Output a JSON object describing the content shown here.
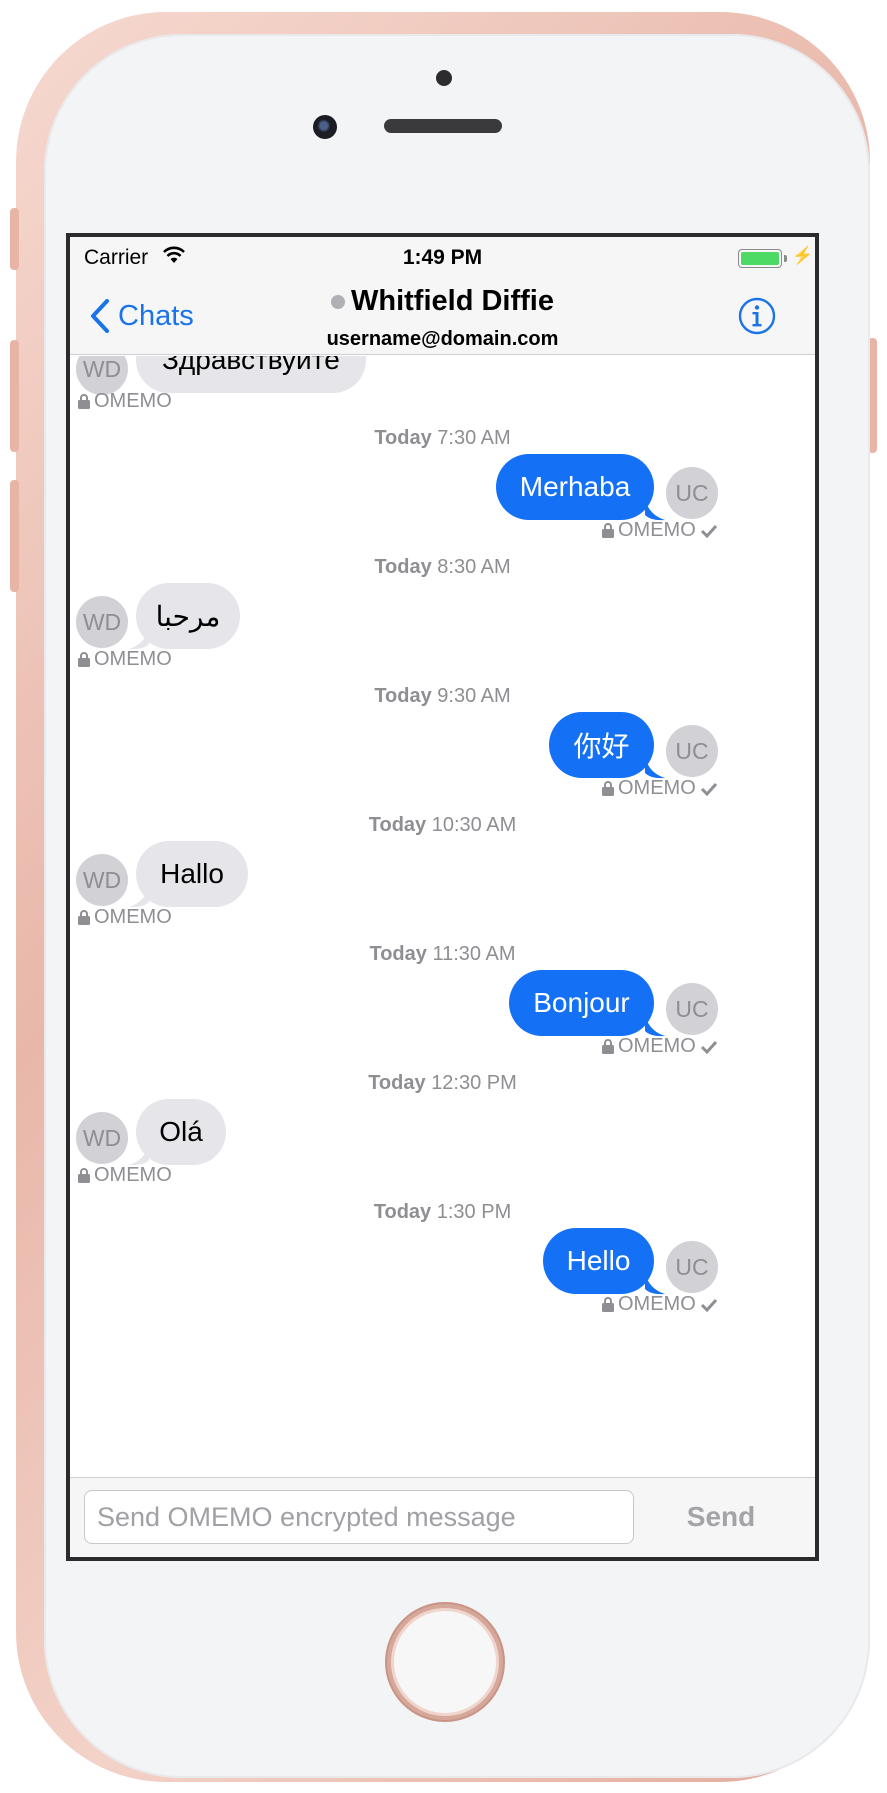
{
  "status_bar": {
    "carrier": "Carrier",
    "time": "1:49 PM"
  },
  "nav": {
    "back_label": "Chats",
    "contact_name": "Whitfield Diffie",
    "contact_address": "username@domain.com",
    "info_icon": "info-icon"
  },
  "colors": {
    "accent": "#1a73e8",
    "outgoing_bubble": "#1471f5",
    "incoming_bubble": "#e5e5ea",
    "battery": "#4cd964"
  },
  "messages": {
    "m0": {
      "avatar": "WD",
      "text": "Здравствуйте",
      "meta": "OMEMO"
    },
    "t1": {
      "day": "Today",
      "time": "7:30 AM"
    },
    "m1": {
      "avatar": "UC",
      "text": "Merhaba",
      "meta": "OMEMO"
    },
    "t2": {
      "day": "Today",
      "time": "8:30 AM"
    },
    "m2": {
      "avatar": "WD",
      "text": "مرحبا",
      "meta": "OMEMO"
    },
    "t3": {
      "day": "Today",
      "time": "9:30 AM"
    },
    "m3": {
      "avatar": "UC",
      "text": "你好",
      "meta": "OMEMO"
    },
    "t4": {
      "day": "Today",
      "time": "10:30 AM"
    },
    "m4": {
      "avatar": "WD",
      "text": "Hallo",
      "meta": "OMEMO"
    },
    "t5": {
      "day": "Today",
      "time": "11:30 AM"
    },
    "m5": {
      "avatar": "UC",
      "text": "Bonjour",
      "meta": "OMEMO"
    },
    "t6": {
      "day": "Today",
      "time": "12:30 PM"
    },
    "m6": {
      "avatar": "WD",
      "text": "Olá",
      "meta": "OMEMO"
    },
    "t7": {
      "day": "Today",
      "time": "1:30 PM"
    },
    "m7": {
      "avatar": "UC",
      "text": "Hello",
      "meta": "OMEMO"
    }
  },
  "input": {
    "placeholder": "Send OMEMO encrypted message",
    "value": "",
    "send_label": "Send"
  }
}
